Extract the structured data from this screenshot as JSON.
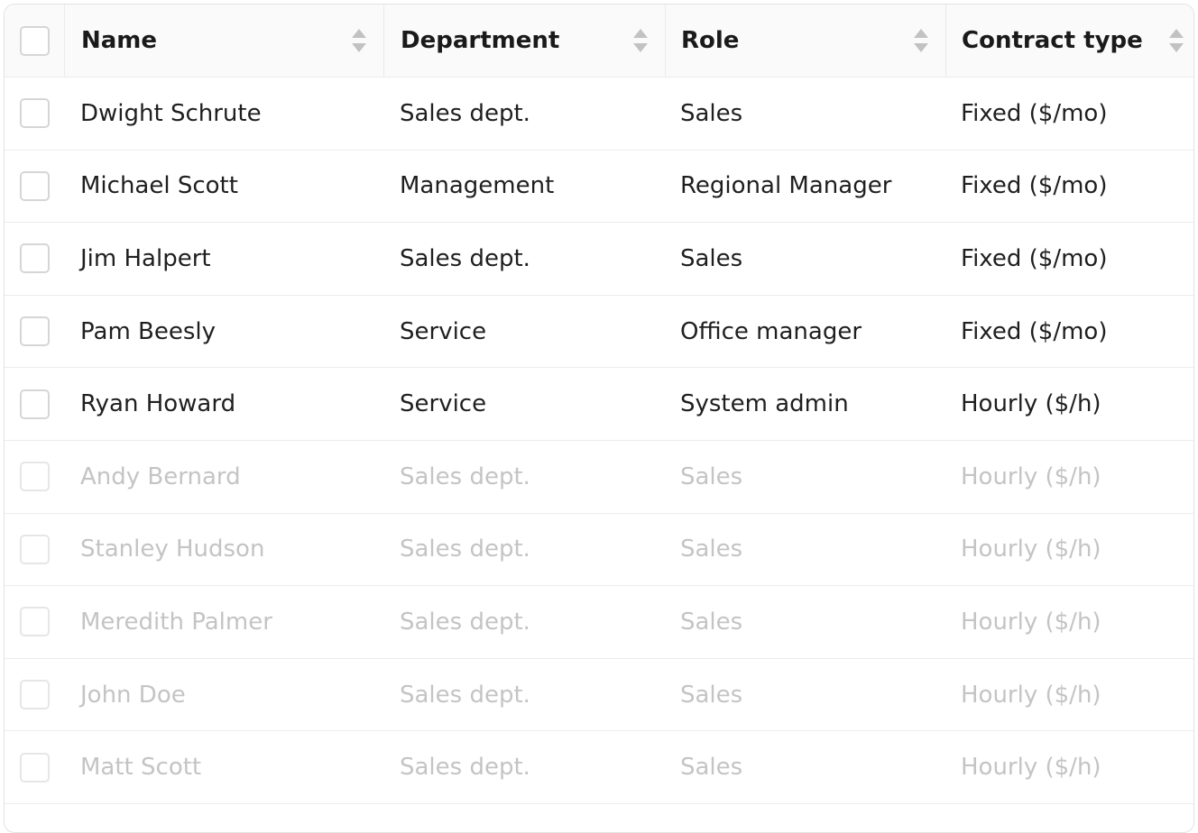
{
  "table": {
    "columns": [
      {
        "key": "name",
        "label": "Name"
      },
      {
        "key": "department",
        "label": "Department"
      },
      {
        "key": "role",
        "label": "Role"
      },
      {
        "key": "contract",
        "label": "Contract type"
      }
    ],
    "rows": [
      {
        "name": "Dwight Schrute",
        "department": "Sales dept.",
        "role": "Sales",
        "contract": "Fixed ($/mo)",
        "dimmed": false
      },
      {
        "name": "Michael Scott",
        "department": "Management",
        "role": "Regional Manager",
        "contract": "Fixed ($/mo)",
        "dimmed": false
      },
      {
        "name": "Jim Halpert",
        "department": "Sales dept.",
        "role": "Sales",
        "contract": "Fixed ($/mo)",
        "dimmed": false
      },
      {
        "name": "Pam Beesly",
        "department": "Service",
        "role": "Office manager",
        "contract": "Fixed ($/mo)",
        "dimmed": false
      },
      {
        "name": "Ryan Howard",
        "department": "Service",
        "role": "System admin",
        "contract": "Hourly ($/h)",
        "dimmed": false
      },
      {
        "name": "Andy Bernard",
        "department": "Sales dept.",
        "role": "Sales",
        "contract": "Hourly ($/h)",
        "dimmed": true
      },
      {
        "name": "Stanley Hudson",
        "department": "Sales dept.",
        "role": "Sales",
        "contract": "Hourly ($/h)",
        "dimmed": true
      },
      {
        "name": "Meredith Palmer",
        "department": "Sales dept.",
        "role": "Sales",
        "contract": "Hourly ($/h)",
        "dimmed": true
      },
      {
        "name": "John Doe",
        "department": "Sales dept.",
        "role": "Sales",
        "contract": "Hourly ($/h)",
        "dimmed": true
      },
      {
        "name": "Matt Scott",
        "department": "Sales dept.",
        "role": "Sales",
        "contract": "Hourly ($/h)",
        "dimmed": true
      }
    ]
  },
  "icons": {
    "sort": "sort-icon",
    "checkbox": "checkbox"
  },
  "colors": {
    "text": "#1f1f1f",
    "text_dimmed": "#c4c4c4",
    "border": "#e3e3e3",
    "header_bg": "#fafafa",
    "sort_icon": "#bdbdbd"
  }
}
